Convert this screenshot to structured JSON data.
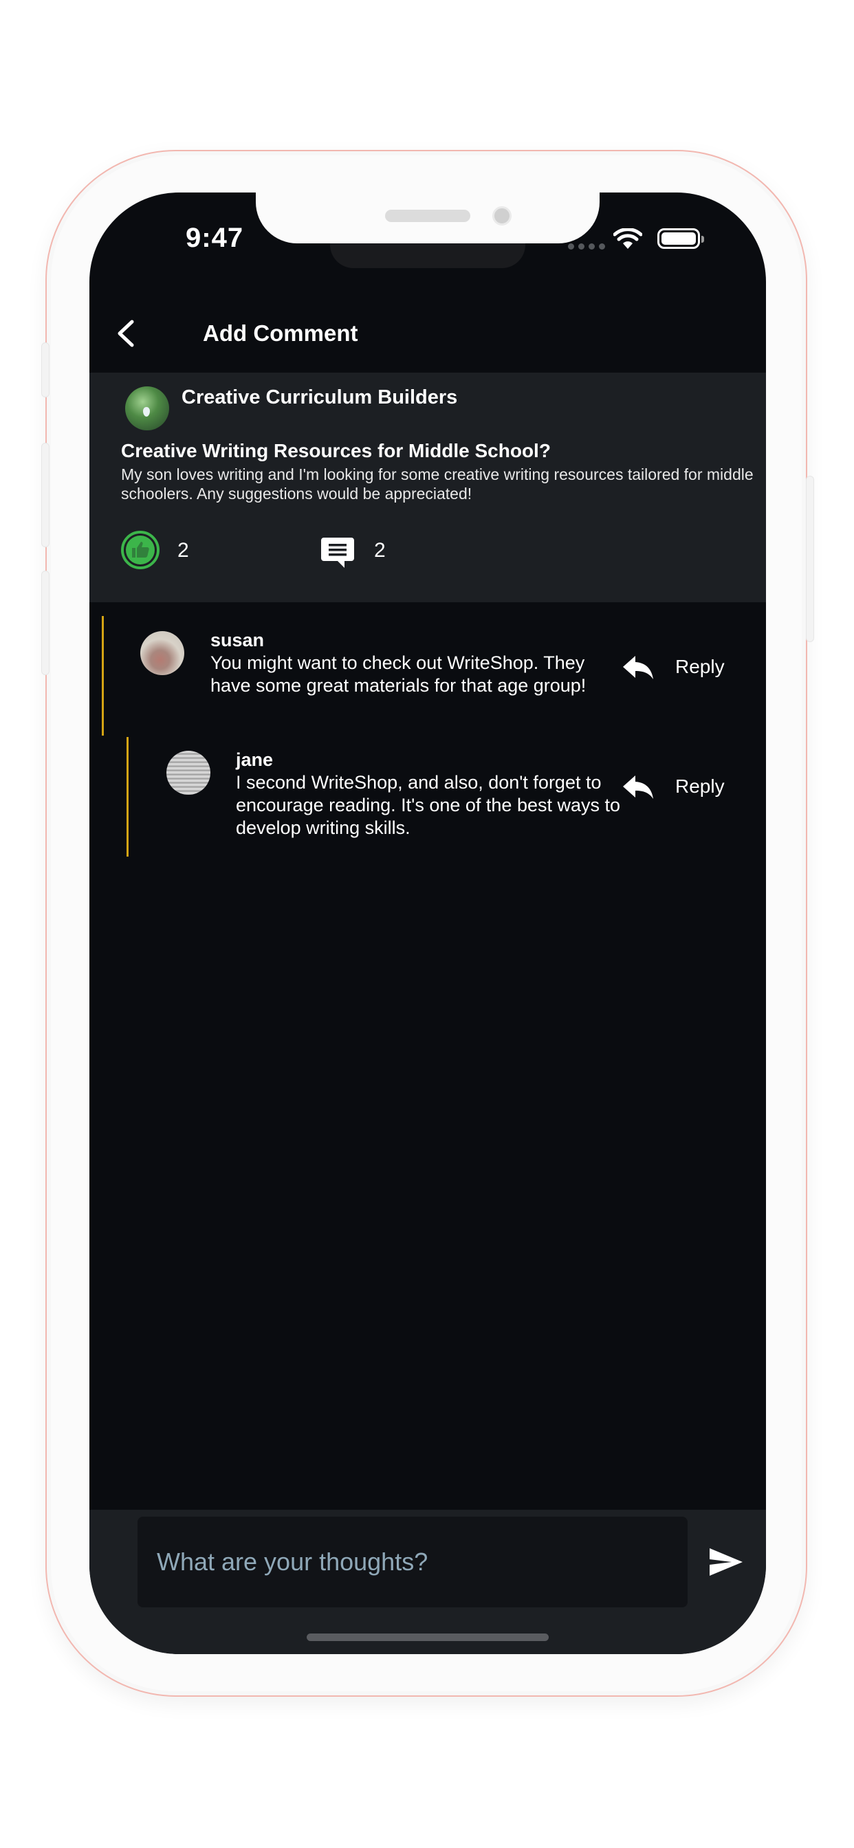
{
  "status_bar": {
    "time": "9:47"
  },
  "header": {
    "title": "Add Comment"
  },
  "post": {
    "group_name": "Creative Curriculum Builders",
    "title": "Creative Writing Resources for Middle School?",
    "body": "My son loves writing and I'm looking for some creative writing resources tailored for middle schoolers. Any suggestions would be appreciated!",
    "like_count": "2",
    "comment_count": "2"
  },
  "comments": [
    {
      "author": "susan",
      "text": "You might want to check out WriteShop. They have some great materials for that age group!",
      "reply_label": "Reply"
    },
    {
      "author": "jane",
      "text": "I second WriteShop, and also, don't forget to encourage reading. It's one of the best ways to develop writing skills.",
      "reply_label": "Reply"
    }
  ],
  "composer": {
    "placeholder": "What are your thoughts?"
  },
  "colors": {
    "background": "#0a0c10",
    "card": "#1c1f23",
    "like_green": "#3cb54a",
    "thread_bar": "#d4a414",
    "placeholder": "#8fa8b8"
  },
  "icons": {
    "back": "chevron-left-icon",
    "like": "thumbs-up-icon",
    "comments": "chat-bubble-icon",
    "reply": "reply-arrow-icon",
    "send": "send-icon"
  }
}
